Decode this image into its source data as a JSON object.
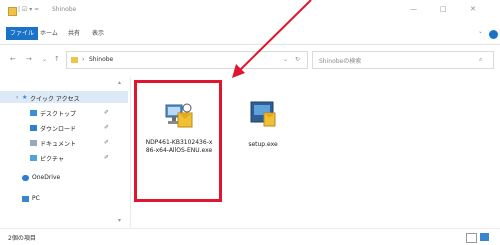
{
  "titlebar": {
    "folder_name": "Shinobe",
    "win_minimize": "—",
    "win_maximize": "□",
    "win_close": "✕"
  },
  "ribbon": {
    "tabs": [
      "ファイル",
      "ホーム",
      "共有",
      "表示"
    ]
  },
  "address": {
    "path_label": "Shinobe",
    "search_placeholder": "Shinobeの検索"
  },
  "nav": {
    "items": [
      {
        "label": "クイック アクセス",
        "icon": "star-icon"
      },
      {
        "label": "デスクトップ",
        "icon": "desktop-icon"
      },
      {
        "label": "ダウンロード",
        "icon": "download-icon"
      },
      {
        "label": "ドキュメント",
        "icon": "document-icon"
      },
      {
        "label": "ピクチャ",
        "icon": "picture-icon"
      },
      {
        "label": "OneDrive",
        "icon": "cloud-icon"
      },
      {
        "label": "PC",
        "icon": "pc-icon"
      }
    ]
  },
  "files": [
    {
      "name": "NDP461-KB3102436-x86-x64-AllOS-ENU.exe",
      "icon": "installer-icon",
      "highlighted": true
    },
    {
      "name": "setup.exe",
      "icon": "setup-icon",
      "highlighted": false
    }
  ],
  "status": {
    "item_count": "2個の項目"
  },
  "annotation": {
    "color": "#e01530"
  }
}
